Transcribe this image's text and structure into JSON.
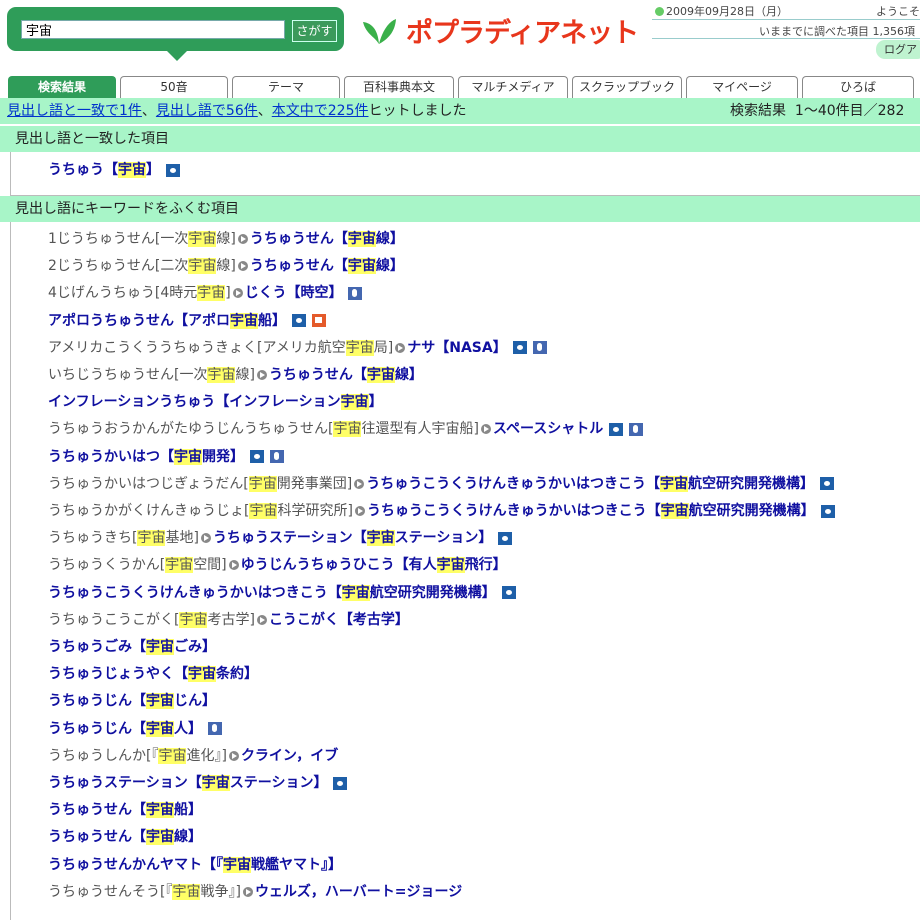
{
  "search": {
    "value": "宇宙",
    "button_label": "さがす"
  },
  "logo": {
    "text": "ポプラディアネット"
  },
  "header": {
    "date": "2009年09月28日（月）",
    "welcome": "ようこそ",
    "lookup_count": "いままでに調べた項目 1,356項",
    "logout_label": "ログア"
  },
  "tabs": [
    {
      "label": "検索結果"
    },
    {
      "label": "50音"
    },
    {
      "label": "テーマ"
    },
    {
      "label": "百科事典本文"
    },
    {
      "label": "マルチメディア"
    },
    {
      "label": "スクラップブック"
    },
    {
      "label": "マイページ"
    },
    {
      "label": "ひろば"
    }
  ],
  "summary": {
    "link1": "見出し語と一致で1件",
    "sep1": "、",
    "link2": "見出し語で56件",
    "sep2": "、",
    "link3": "本文中で225件",
    "suffix": "ヒットしました",
    "results_label": "検索結果",
    "range": "1〜40件目／282"
  },
  "sections": {
    "exact_title": "見出し語と一致した項目",
    "contains_title": "見出し語にキーワードをふくむ項目"
  },
  "exact_entries": [
    {
      "link_pre": "うちゅう【",
      "link_hl": "宇宙",
      "link_post": "】",
      "icons": [
        "camera"
      ]
    }
  ],
  "entries": [
    {
      "r_pre": "1じうちゅうせん[一次",
      "r_hl": "宇宙",
      "r_post": "線]",
      "l_pre": "うちゅうせん【",
      "l_hl": "宇宙",
      "l_post": "線】",
      "icons": []
    },
    {
      "r_pre": "2じうちゅうせん[二次",
      "r_hl": "宇宙",
      "r_post": "線]",
      "l_pre": "うちゅうせん【",
      "l_hl": "宇宙",
      "l_post": "線】",
      "icons": []
    },
    {
      "r_pre": "4じげんうちゅう[4時元",
      "r_hl": "宇宙",
      "r_post": "]",
      "l_pre": "じくう【時空】",
      "l_hl": "",
      "l_post": "",
      "icons": [
        "audio"
      ]
    },
    {
      "r_pre": "",
      "r_hl": "",
      "r_post": "",
      "l_pre": "アポロうちゅうせん【アポロ",
      "l_hl": "宇宙",
      "l_post": "船】",
      "icons": [
        "camera",
        "video"
      ]
    },
    {
      "r_pre": "アメリカこうくううちゅうきょく[アメリカ航空",
      "r_hl": "宇宙",
      "r_post": "局]",
      "l_pre": "ナサ【NASA】",
      "l_hl": "",
      "l_post": "",
      "icons": [
        "camera",
        "audio"
      ]
    },
    {
      "r_pre": "いちじうちゅうせん[一次",
      "r_hl": "宇宙",
      "r_post": "線]",
      "l_pre": "うちゅうせん【",
      "l_hl": "宇宙",
      "l_post": "線】",
      "icons": []
    },
    {
      "r_pre": "",
      "r_hl": "",
      "r_post": "",
      "l_pre": "インフレーションうちゅう【インフレーション",
      "l_hl": "宇宙",
      "l_post": "】",
      "icons": []
    },
    {
      "r_pre": "うちゅうおうかんがたゆうじんうちゅうせん[",
      "r_hl": "宇宙",
      "r_post": "往還型有人宇宙船]",
      "l_pre": "スペースシャトル",
      "l_hl": "",
      "l_post": "",
      "icons": [
        "camera",
        "audio"
      ]
    },
    {
      "r_pre": "",
      "r_hl": "",
      "r_post": "",
      "l_pre": "うちゅうかいはつ【",
      "l_hl": "宇宙",
      "l_post": "開発】",
      "icons": [
        "camera",
        "audio"
      ]
    },
    {
      "r_pre": "うちゅうかいはつじぎょうだん[",
      "r_hl": "宇宙",
      "r_post": "開発事業団]",
      "l_pre": "うちゅうこうくうけんきゅうかいはつきこう【",
      "l_hl": "宇宙",
      "l_post": "航空研究開発機構】",
      "icons": [
        "camera"
      ]
    },
    {
      "r_pre": "うちゅうかがくけんきゅうじょ[",
      "r_hl": "宇宙",
      "r_post": "科学研究所]",
      "l_pre": "うちゅうこうくうけんきゅうかいはつきこう【",
      "l_hl": "宇宙",
      "l_post": "航空研究開発機構】",
      "icons": [
        "camera"
      ]
    },
    {
      "r_pre": "うちゅうきち[",
      "r_hl": "宇宙",
      "r_post": "基地]",
      "l_pre": "うちゅうステーション【",
      "l_hl": "宇宙",
      "l_post": "ステーション】",
      "icons": [
        "camera"
      ]
    },
    {
      "r_pre": "うちゅうくうかん[",
      "r_hl": "宇宙",
      "r_post": "空間]",
      "l_pre": "ゆうじんうちゅうひこう【有人",
      "l_hl": "宇宙",
      "l_post": "飛行】",
      "icons": []
    },
    {
      "r_pre": "",
      "r_hl": "",
      "r_post": "",
      "l_pre": "うちゅうこうくうけんきゅうかいはつきこう【",
      "l_hl": "宇宙",
      "l_post": "航空研究開発機構】",
      "icons": [
        "camera"
      ]
    },
    {
      "r_pre": "うちゅうこうこがく[",
      "r_hl": "宇宙",
      "r_post": "考古学]",
      "l_pre": "こうこがく【考古学】",
      "l_hl": "",
      "l_post": "",
      "icons": []
    },
    {
      "r_pre": "",
      "r_hl": "",
      "r_post": "",
      "l_pre": "うちゅうごみ【",
      "l_hl": "宇宙",
      "l_post": "ごみ】",
      "icons": []
    },
    {
      "r_pre": "",
      "r_hl": "",
      "r_post": "",
      "l_pre": "うちゅうじょうやく【",
      "l_hl": "宇宙",
      "l_post": "条約】",
      "icons": []
    },
    {
      "r_pre": "",
      "r_hl": "",
      "r_post": "",
      "l_pre": "うちゅうじん【",
      "l_hl": "宇宙",
      "l_post": "じん】",
      "icons": []
    },
    {
      "r_pre": "",
      "r_hl": "",
      "r_post": "",
      "l_pre": "うちゅうじん【",
      "l_hl": "宇宙",
      "l_post": "人】",
      "icons": [
        "audio"
      ]
    },
    {
      "r_pre": "うちゅうしんか[『",
      "r_hl": "宇宙",
      "r_post": "進化』]",
      "l_pre": "クライン，イブ",
      "l_hl": "",
      "l_post": "",
      "icons": []
    },
    {
      "r_pre": "",
      "r_hl": "",
      "r_post": "",
      "l_pre": "うちゅうステーション【",
      "l_hl": "宇宙",
      "l_post": "ステーション】",
      "icons": [
        "camera"
      ]
    },
    {
      "r_pre": "",
      "r_hl": "",
      "r_post": "",
      "l_pre": "うちゅうせん【",
      "l_hl": "宇宙",
      "l_post": "船】",
      "icons": []
    },
    {
      "r_pre": "",
      "r_hl": "",
      "r_post": "",
      "l_pre": "うちゅうせん【",
      "l_hl": "宇宙",
      "l_post": "線】",
      "icons": []
    },
    {
      "r_pre": "",
      "r_hl": "",
      "r_post": "",
      "l_pre": "うちゅうせんかんヤマト【『",
      "l_hl": "宇宙",
      "l_post": "戦艦ヤマト』】",
      "icons": []
    },
    {
      "r_pre": "うちゅうせんそう[『",
      "r_hl": "宇宙",
      "r_post": "戦争』]",
      "l_pre": "ウェルズ，ハーバート=ジョージ",
      "l_hl": "",
      "l_post": "",
      "icons": []
    }
  ]
}
